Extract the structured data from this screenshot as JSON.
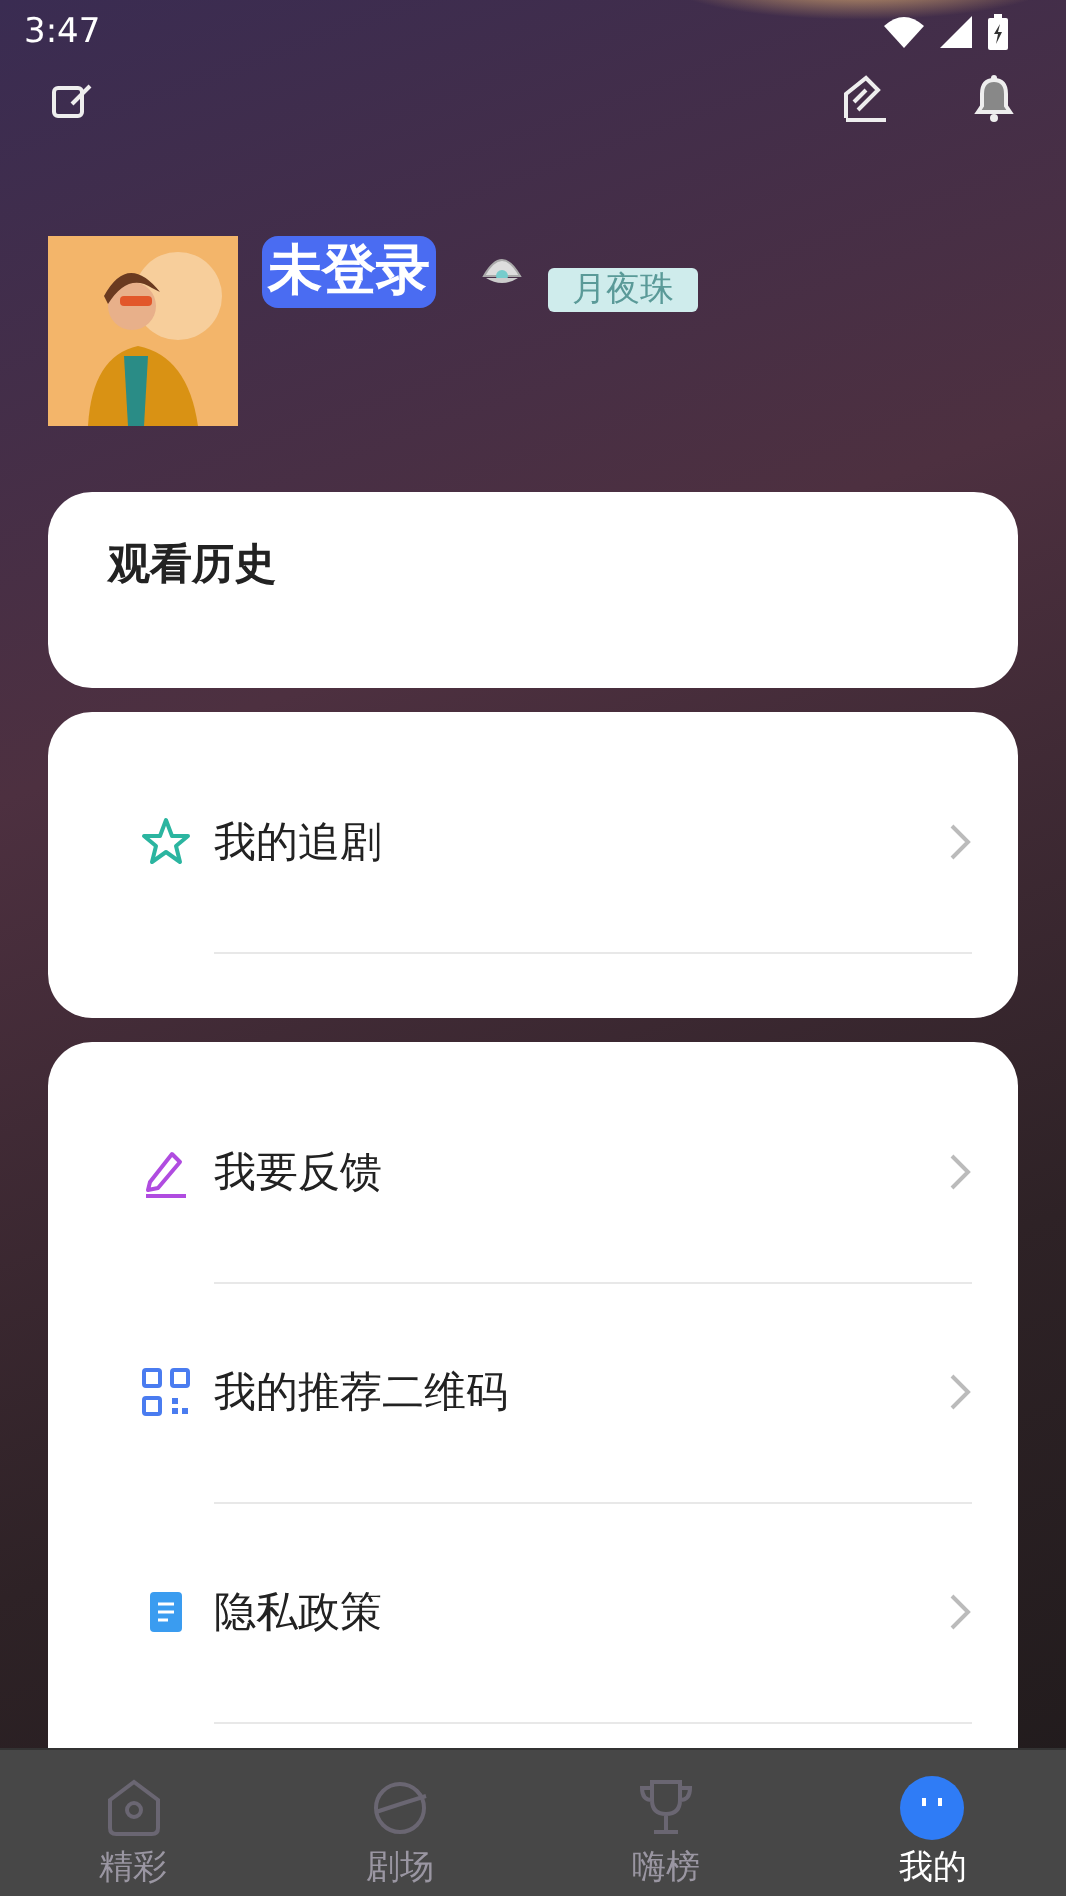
{
  "status_bar": {
    "time": "3:47"
  },
  "profile": {
    "name": "未登录",
    "badge": "月夜珠"
  },
  "history_card": {
    "title": "观看历史"
  },
  "menu_groups": [
    {
      "items": [
        {
          "label": "我的追剧",
          "kind": "star"
        }
      ]
    },
    {
      "items": [
        {
          "label": "我要反馈",
          "kind": "pencil"
        },
        {
          "label": "我的推荐二维码",
          "kind": "qr"
        },
        {
          "label": "隐私政策",
          "kind": "doc"
        }
      ]
    }
  ],
  "tab_bar": [
    {
      "label": "精彩",
      "kind": "home",
      "selected": false
    },
    {
      "label": "剧场",
      "kind": "planet",
      "selected": false
    },
    {
      "label": "嗨榜",
      "kind": "trophy",
      "selected": false
    },
    {
      "label": "我的",
      "kind": "face",
      "selected": true
    }
  ]
}
